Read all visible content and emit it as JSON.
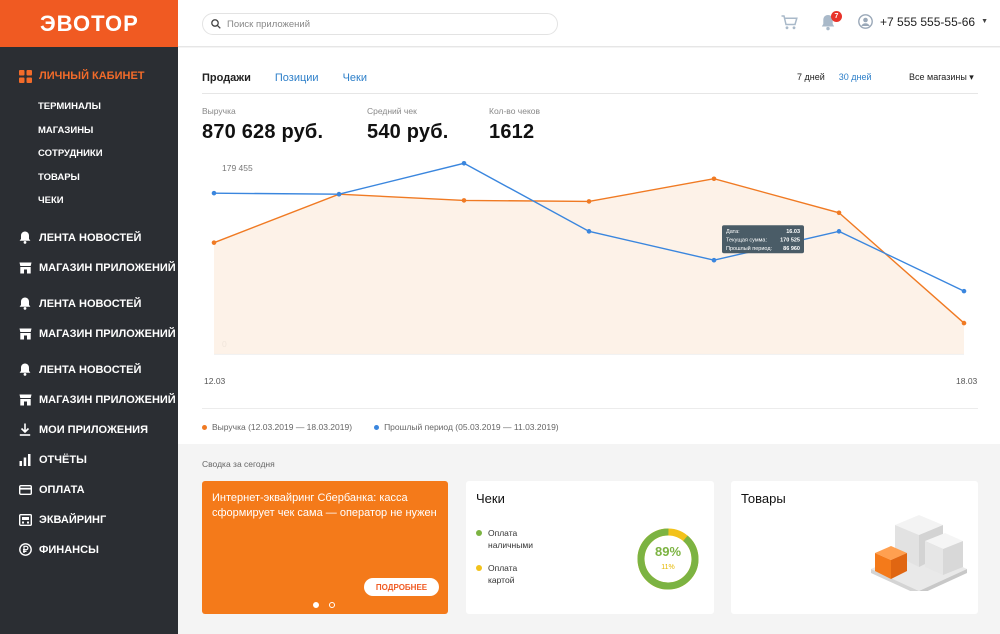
{
  "sidebar": {
    "logo": "ЭВОТОР",
    "active": {
      "label": "ЛИЧНЫЙ КАБИНЕТ",
      "icon": "grid-icon"
    },
    "sub_items": [
      "ТЕРМИНАЛЫ",
      "МАГАЗИНЫ",
      "СОТРУДНИКИ",
      "ТОВАРЫ",
      "ЧЕКИ"
    ],
    "items": [
      {
        "label": "ЛЕНТА НОВОСТЕЙ",
        "icon": "bell-icon"
      },
      {
        "label": "МАГАЗИН ПРИЛОЖЕНИЙ",
        "icon": "store-icon"
      },
      {
        "label": "ЛЕНТА НОВОСТЕЙ",
        "icon": "bell-icon"
      },
      {
        "label": "МАГАЗИН ПРИЛОЖЕНИЙ",
        "icon": "store-icon"
      },
      {
        "label": "ЛЕНТА НОВОСТЕЙ",
        "icon": "bell-icon"
      },
      {
        "label": "МАГАЗИН ПРИЛОЖЕНИЙ",
        "icon": "store-icon"
      },
      {
        "label": "МОИ ПРИЛОЖЕНИЯ",
        "icon": "download-icon"
      },
      {
        "label": "ОТЧЁТЫ",
        "icon": "bar-chart-icon"
      },
      {
        "label": "ОПЛАТА",
        "icon": "card-icon"
      },
      {
        "label": "ЭКВАЙРИНГ",
        "icon": "terminal-icon"
      },
      {
        "label": "ФИНАНСЫ",
        "icon": "ruble-icon"
      }
    ]
  },
  "header": {
    "search_placeholder": "Поиск приложений",
    "notifications_count": "7",
    "phone": "+7 555 555-55-66"
  },
  "main": {
    "tabs": [
      {
        "label": "Продажи",
        "active": true
      },
      {
        "label": "Позиции",
        "active": false
      },
      {
        "label": "Чеки",
        "active": false
      }
    ],
    "period_7": "7 дней",
    "period_30": "30 дней",
    "stores": "Все магазины ▾",
    "metrics": [
      {
        "label": "Выручка",
        "value": "870 628 руб."
      },
      {
        "label": "Средний чек",
        "value": "540 руб."
      },
      {
        "label": "Кол-во чеков",
        "value": "1612"
      }
    ]
  },
  "chart_data": {
    "type": "line",
    "x": [
      "12.03",
      "13.03",
      "14.03",
      "15.03",
      "16.03",
      "17.03",
      "18.03"
    ],
    "x_labels_shown": [
      "12.03",
      "18.03"
    ],
    "y_ticks": [
      "179 455",
      "0"
    ],
    "ylim": [
      0,
      179455
    ],
    "series": [
      {
        "name": "Выручка (12.03.2019 — 18.03.2019)",
        "color": "#f07a23",
        "area": true,
        "values": [
          108000,
          155000,
          149000,
          148000,
          170000,
          137000,
          30000
        ]
      },
      {
        "name": "Прошлый период (05.03.2019 — 11.03.2019)",
        "color": "#3a86de",
        "area": false,
        "values": [
          156000,
          155000,
          185000,
          119000,
          91000,
          119000,
          61000
        ]
      }
    ],
    "tooltip": {
      "rows": [
        {
          "label": "Дата:",
          "value": "16.03"
        },
        {
          "label": "Текущая сумма:",
          "value": "170 525"
        },
        {
          "label": "Прошлый период:",
          "value": "86 960"
        }
      ]
    }
  },
  "summary": {
    "title": "Сводка за сегодня",
    "promo": {
      "text": "Интернет-эквайринг Сбербанка: касса сформирует чек сама — оператор не нужен",
      "button": "ПОДРОБНЕЕ"
    },
    "checks": {
      "title": "Чеки",
      "cash_line1": "Оплата",
      "cash_line2": "наличными",
      "cash_color": "#7cb342",
      "card_line1": "Оплата",
      "card_line2": "картой",
      "card_color": "#f2c21b",
      "cash_share": 89,
      "big_pct": "89%",
      "small_pct": "11%"
    },
    "goods": {
      "title": "Товары"
    }
  }
}
